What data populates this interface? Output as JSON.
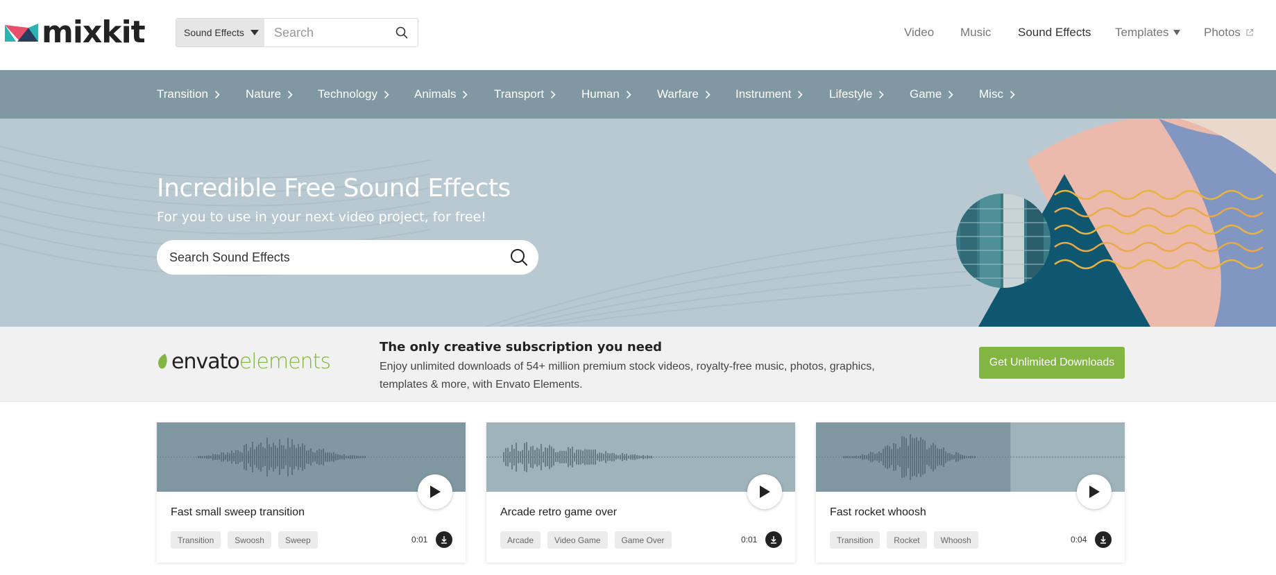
{
  "header": {
    "logo_text": "mixkit",
    "search": {
      "type_label": "Sound Effects",
      "placeholder": "Search"
    },
    "nav": {
      "video": "Video",
      "music": "Music",
      "sound_effects": "Sound Effects",
      "templates": "Templates",
      "photos": "Photos"
    }
  },
  "categories": [
    "Transition",
    "Nature",
    "Technology",
    "Animals",
    "Transport",
    "Human",
    "Warfare",
    "Instrument",
    "Lifestyle",
    "Game",
    "Misc"
  ],
  "hero": {
    "title": "Incredible Free Sound Effects",
    "subtitle": "For you to use in your next video project, for free!",
    "search_placeholder": "Search Sound Effects"
  },
  "envato": {
    "logo_word1": "envato",
    "logo_word2": "elements",
    "heading": "The only creative subscription you need",
    "text": "Enjoy unlimited downloads of 54+ million premium stock videos, royalty-free music, photos, graphics, templates & more, with Envato Elements.",
    "button": "Get Unlimited Downloads"
  },
  "cards": [
    {
      "title": "Fast small sweep transition",
      "tags": [
        "Transition",
        "Swoosh",
        "Sweep"
      ],
      "duration": "0:01",
      "progress": 1.0
    },
    {
      "title": "Arcade retro game over",
      "tags": [
        "Arcade",
        "Video Game",
        "Game Over"
      ],
      "duration": "0:01",
      "progress": 0.0
    },
    {
      "title": "Fast rocket whoosh",
      "tags": [
        "Transition",
        "Rocket",
        "Whoosh"
      ],
      "duration": "0:04",
      "progress": 0.63
    }
  ],
  "colors": {
    "brand_teal": "#2bb3b1",
    "brand_pink": "#e94f6b",
    "brand_navy": "#263e5c",
    "category_bar": "#7f98a2",
    "hero_bg": "#b9c9d2",
    "envato_green": "#82b541",
    "wave_played": "#7f98a2",
    "wave_unplayed": "#9fb3bb"
  },
  "icons": {
    "search": "search-icon",
    "caret": "caret-down-icon",
    "chevron": "chevron-right-icon",
    "external": "external-link-icon",
    "play": "play-icon",
    "download": "download-icon"
  }
}
